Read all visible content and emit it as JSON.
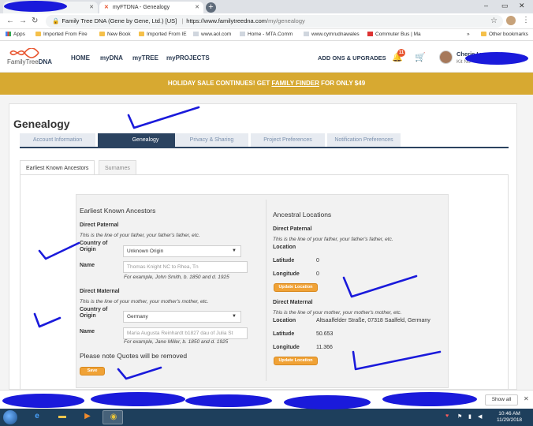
{
  "browser": {
    "tabs": [
      {
        "title": ""
      },
      {
        "title": "myFTDNA - Genealogy"
      }
    ],
    "new_tab": "+",
    "address": {
      "site_label": "Family Tree DNA (Gene by Gene, Ltd.) [US]",
      "separator": "|",
      "url_host": "https://www.familytreedna.com",
      "url_path": "/my/genealogy"
    },
    "bookmarks": [
      {
        "label": "Apps",
        "icon": "apps-icon"
      },
      {
        "label": "Imported From Fire",
        "icon": "folder-icon"
      },
      {
        "label": "New Book",
        "icon": "folder-icon"
      },
      {
        "label": "Imported From IE",
        "icon": "folder-icon"
      },
      {
        "label": "www.aol.com",
        "icon": "page-icon"
      },
      {
        "label": "Home - MTA.Comm",
        "icon": "page-icon"
      },
      {
        "label": "www.cymrudnawales",
        "icon": "page-icon"
      },
      {
        "label": "Commuter Bus | Ma",
        "icon": "red-icon"
      },
      {
        "label": "»",
        "icon": ""
      },
      {
        "label": "Other bookmarks",
        "icon": "folder-icon"
      }
    ]
  },
  "site": {
    "logo_text_prefix": "FamilyTree",
    "logo_text_bold": "DNA",
    "nav": [
      "HOME",
      "myDNA",
      "myTREE",
      "myPROJECTS"
    ],
    "addons": "ADD ONS & UPGRADES",
    "notification_count": "11",
    "user_name": "Cherie Lynn",
    "kit_label": "Kit No"
  },
  "promo": {
    "prefix": "HOLIDAY SALE CONTINUES! GET ",
    "link": "FAMILY FINDER",
    "suffix": " FOR ONLY $49"
  },
  "page": {
    "title": "Genealogy",
    "tabs": [
      "Account Information",
      "Genealogy",
      "Privacy & Sharing",
      "Project Preferences",
      "Notification Preferences"
    ],
    "subtabs": [
      "Earliest Known Ancestors",
      "Surnames"
    ]
  },
  "eka": {
    "heading": "Earliest Known Ancestors",
    "paternal": {
      "heading": "Direct Paternal",
      "note": "This is the line of your father, your father's father, etc.",
      "country_label_1": "Country of",
      "country_label_2": "Origin",
      "country_value": "Unknown Origin",
      "name_label": "Name",
      "name_value": "Thomas Knight NC to Rhea, Tn",
      "name_hint": "For example, John Smith, b. 1850 and d. 1925"
    },
    "maternal": {
      "heading": "Direct Maternal",
      "note": "This is the line of your mother, your mother's mother, etc.",
      "country_label_1": "Country of",
      "country_label_2": "Origin",
      "country_value": "Germany",
      "name_label": "Name",
      "name_value": "Maria Augusta Reinhardt b1827 dau of Julia St",
      "name_hint": "For example, Jane Miller, b. 1850 and d. 1925"
    },
    "quotes_note": "Please note Quotes will be removed",
    "save_label": "Save"
  },
  "ancestral": {
    "heading": "Ancestral Locations",
    "paternal": {
      "heading": "Direct Paternal",
      "note": "This is the line of your father, your father's father, etc.",
      "location_label": "Location",
      "location_value": "",
      "latitude_label": "Latitude",
      "latitude_value": "0",
      "longitude_label": "Longitude",
      "longitude_value": "0",
      "button": "Update Location"
    },
    "maternal": {
      "heading": "Direct Maternal",
      "note": "This is the line of your mother, your mother's mother, etc.",
      "location_label": "Location",
      "location_value": "Altsaalfelder Straße, 07318 Saalfeld, Germany",
      "latitude_label": "Latitude",
      "latitude_value": "50.653",
      "longitude_label": "Longitude",
      "longitude_value": "11.366",
      "button": "Update Location"
    }
  },
  "downloads": {
    "show_all": "Show all"
  },
  "taskbar": {
    "time": "10:46 AM",
    "date": "11/29/2018"
  },
  "colors": {
    "promo": "#d7a931",
    "active_tab": "#2b4360",
    "button": "#f0a236",
    "scribble": "#1a1adb"
  }
}
